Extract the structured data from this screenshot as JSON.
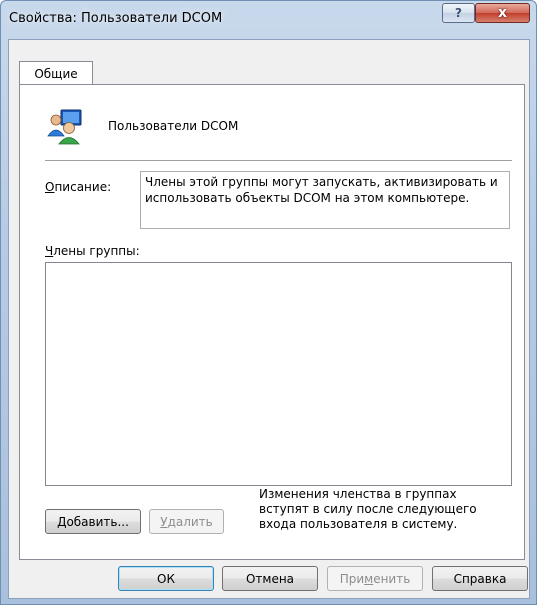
{
  "window": {
    "title": "Свойства: Пользователи DCOM",
    "help_glyph": "?",
    "close_glyph": "x"
  },
  "tabs": [
    {
      "label": "Общие",
      "selected": true
    }
  ],
  "general": {
    "icon": "group-users-icon",
    "group_name": "Пользователи DCOM",
    "description_label": {
      "accel": "О",
      "rest": "писание:"
    },
    "description_text": "Члены этой группы могут запускать, активизировать и использовать объекты DCOM на этом компьютере.",
    "members_label": {
      "accel": "Ч",
      "rest": "лены группы:"
    },
    "members": [],
    "add_button": {
      "accel": "Д",
      "rest": "обавить..."
    },
    "remove_button": {
      "accel": "У",
      "rest": "далить"
    },
    "note": "Изменения членства в группах вступят в силу после следующего входа пользователя в систему."
  },
  "footer": {
    "ok": "ОК",
    "cancel": "Отмена",
    "apply": {
      "before": "При",
      "accel": "м",
      "after": "енить"
    },
    "help": "Справка"
  },
  "colors": {
    "title_gradient_top": "#c9d9ec",
    "close_button": "#c23f2d",
    "default_button_border": "#3c7fb1"
  }
}
